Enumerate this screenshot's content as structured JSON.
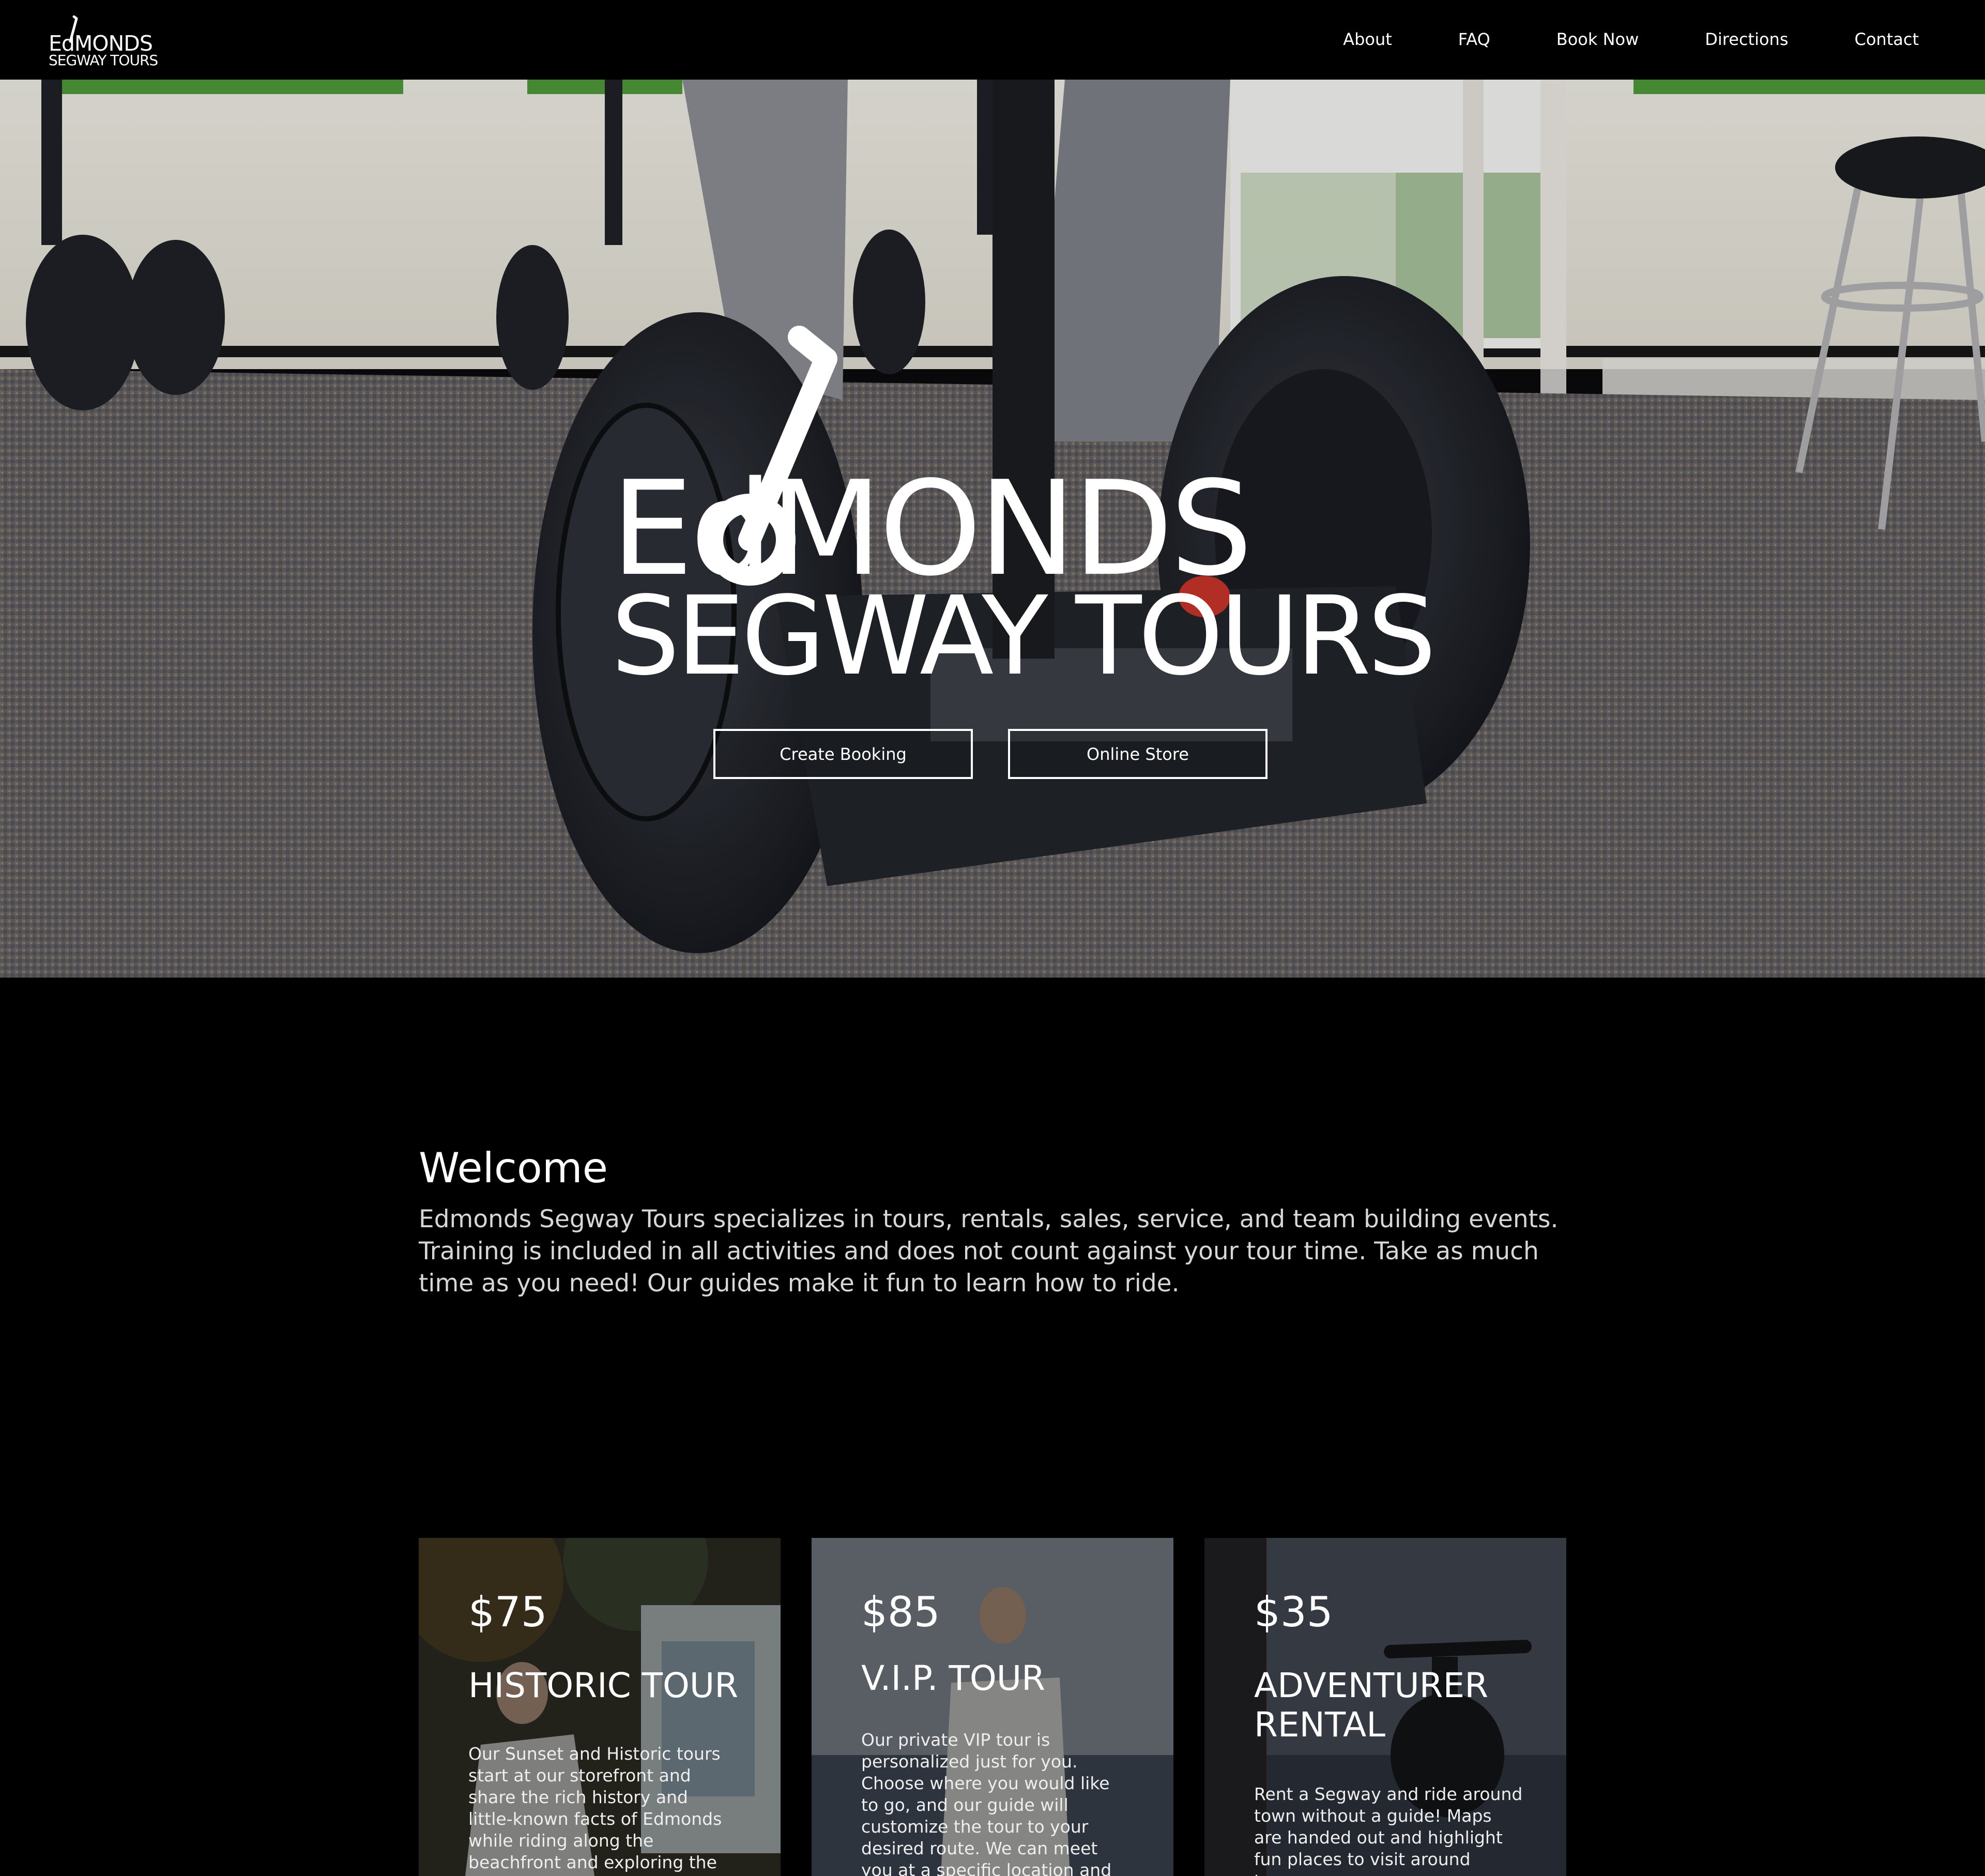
{
  "nav": {
    "logo": {
      "line1": "EdMONDS",
      "line2": "SEGWAY TOURS"
    },
    "links": [
      "About",
      "FAQ",
      "Book Now",
      "Directions",
      "Contact"
    ]
  },
  "hero": {
    "title_line1": "EdMONDS",
    "title_line2": "SEGWAY TOURS",
    "buttons": {
      "booking": "Create Booking",
      "store": "Online Store"
    }
  },
  "welcome": {
    "heading": "Welcome",
    "body": "Edmonds Segway Tours specializes in tours, rentals, sales, service, and team building events. Training is included in all activities and does not count against your tour time. Take as much time as you need! Our guides make it fun to learn how to ride."
  },
  "cards": [
    {
      "price": "$75",
      "title": "HISTORIC TOUR",
      "description": "Our Sunset and Historic tours start at our storefront and share the rich history and little-known facts of Edmonds while riding along the beachfront and exploring the downtown area."
    },
    {
      "price": "$85",
      "title": "V.I.P. TOUR",
      "description": "Our private VIP tour is personalized just for you. Choose where you would like to go, and our guide will customize the tour to your desired route. We can meet you at a specific location and bring your Segway to you!"
    },
    {
      "price": "$35",
      "title": "ADVENTURER RENTAL",
      "description": "Rent a Segway and ride around town without a guide! Maps are handed out and highlight fun places to visit around town."
    }
  ]
}
